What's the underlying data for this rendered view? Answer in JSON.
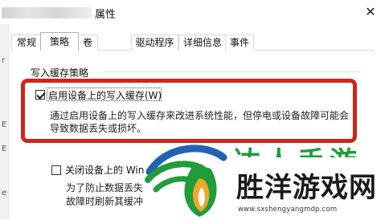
{
  "window": {
    "title": "属性",
    "close_glyph": "✕"
  },
  "left_strip": [
    "r",
    "E",
    "E",
    "e"
  ],
  "tabs": [
    {
      "label": "常规",
      "active": false
    },
    {
      "label": "策略",
      "active": true
    },
    {
      "label": "卷",
      "active": false
    },
    {
      "label": "驱动程序",
      "active": false
    },
    {
      "label": "详细信息",
      "active": false
    },
    {
      "label": "事件",
      "active": false
    }
  ],
  "write_cache": {
    "group_label": "写入缓存策略",
    "enable_option": {
      "label": "启用设备上的写入缓存(W)",
      "checked": true
    },
    "enable_desc": [
      "通过启用设备上的写入缓存来改进系统性能，但停电或设备故障可能会",
      "导致数据丢失或损坏。"
    ],
    "flush_option": {
      "label": "关闭设备上的 Win",
      "checked": false
    },
    "flush_desc": [
      "为了防止数据丢失",
      "故障时刷新其缓冲"
    ]
  },
  "watermark": {
    "top_text": "达人手游",
    "main_text": "胜洋游戏网",
    "url": "www.sxshengyangmdp.com",
    "colors": {
      "green": "#1e9d3a",
      "blue": "#1f63b5",
      "orange": "#f2a62a"
    }
  },
  "colors": {
    "highlight_border": "#d1241a"
  }
}
